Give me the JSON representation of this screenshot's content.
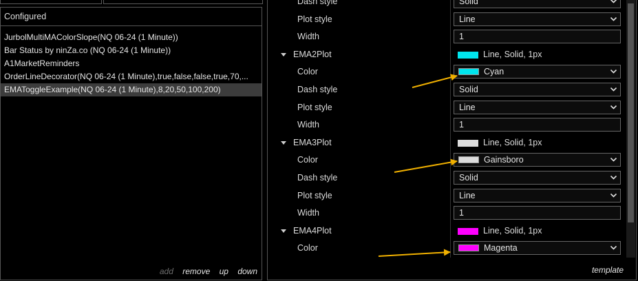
{
  "left": {
    "header": "Configured",
    "items": [
      "JurbolMultiMAColorSlope(NQ 06-24 (1 Minute))",
      "Bar Status by ninZa.co (NQ 06-24 (1 Minute))",
      "A1MarketReminders",
      "OrderLineDecorator(NQ 06-24 (1 Minute),true,false,false,true,70,...",
      "EMAToggleExample(NQ 06-24 (1 Minute),8,20,50,100,200)"
    ],
    "selected_index": 4,
    "actions": {
      "add": "add",
      "remove": "remove",
      "up": "up",
      "down": "down"
    }
  },
  "right": {
    "rows": [
      {
        "kind": "field",
        "label": "Dash style",
        "value": "Solid",
        "control": "dropdown"
      },
      {
        "kind": "field",
        "label": "Plot style",
        "value": "Line",
        "control": "dropdown"
      },
      {
        "kind": "field",
        "label": "Width",
        "value": "1",
        "control": "text"
      },
      {
        "kind": "group",
        "label": "EMA2Plot",
        "summary": "Line, Solid, 1px",
        "color": "#00e5ee"
      },
      {
        "kind": "field",
        "label": "Color",
        "value": "Cyan",
        "control": "color",
        "color": "#00e5ee"
      },
      {
        "kind": "field",
        "label": "Dash style",
        "value": "Solid",
        "control": "dropdown"
      },
      {
        "kind": "field",
        "label": "Plot style",
        "value": "Line",
        "control": "dropdown"
      },
      {
        "kind": "field",
        "label": "Width",
        "value": "1",
        "control": "text"
      },
      {
        "kind": "group",
        "label": "EMA3Plot",
        "summary": "Line, Solid, 1px",
        "color": "#dcdcdc"
      },
      {
        "kind": "field",
        "label": "Color",
        "value": "Gainsboro",
        "control": "color",
        "color": "#dcdcdc"
      },
      {
        "kind": "field",
        "label": "Dash style",
        "value": "Solid",
        "control": "dropdown"
      },
      {
        "kind": "field",
        "label": "Plot style",
        "value": "Line",
        "control": "dropdown"
      },
      {
        "kind": "field",
        "label": "Width",
        "value": "1",
        "control": "text"
      },
      {
        "kind": "group",
        "label": "EMA4Plot",
        "summary": "Line, Solid, 1px",
        "color": "#ff00ff"
      },
      {
        "kind": "field",
        "label": "Color",
        "value": "Magenta",
        "control": "color",
        "color": "#ff00ff"
      }
    ],
    "template_link": "template"
  },
  "annotation_color": "#f0b000"
}
